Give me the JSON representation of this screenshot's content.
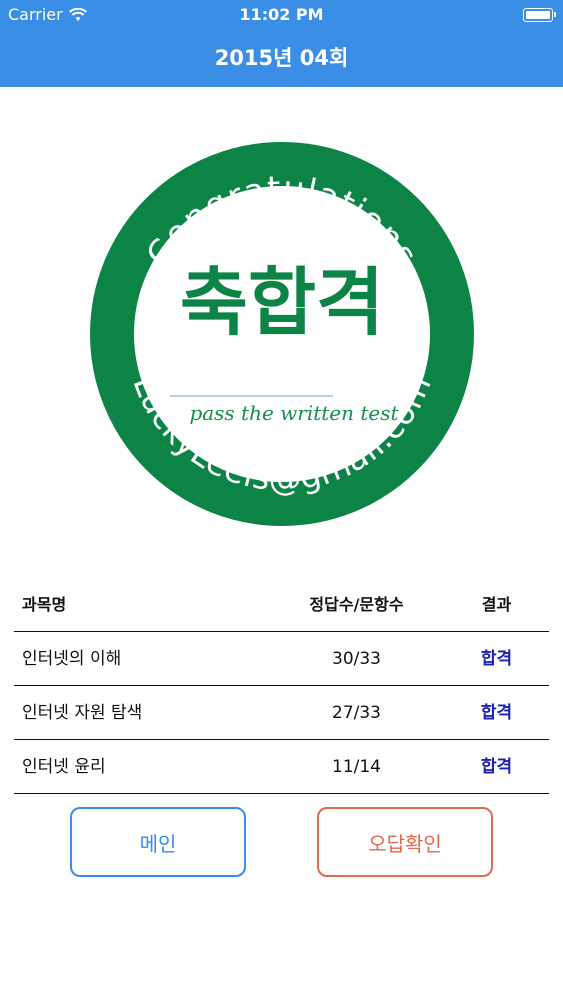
{
  "status_bar": {
    "carrier": "Carrier",
    "time": "11:02 PM",
    "battery_level": 1.0
  },
  "nav": {
    "title": "2015년 04회"
  },
  "badge": {
    "top_text": "Congratulations",
    "main_text": "축합격",
    "sub_text": "pass the written test",
    "bottom_text": "LuckyLeeis@gmail.com",
    "ring_color": "#0c8446",
    "sub_text_color": "#138f4b"
  },
  "table": {
    "headers": {
      "subject": "과목명",
      "score": "정답수/문항수",
      "result": "결과"
    },
    "rows": [
      {
        "subject": "인터넷의 이해",
        "score": "30/33",
        "result": "합격"
      },
      {
        "subject": "인터넷 자원 탐색",
        "score": "27/33",
        "result": "합격"
      },
      {
        "subject": "인터넷 윤리",
        "score": "11/14",
        "result": "합격"
      }
    ]
  },
  "buttons": {
    "main": "메인",
    "review": "오답확인"
  },
  "colors": {
    "header": "#3a8ee6",
    "pass": "#1a20b4",
    "review": "#e06a4e"
  }
}
